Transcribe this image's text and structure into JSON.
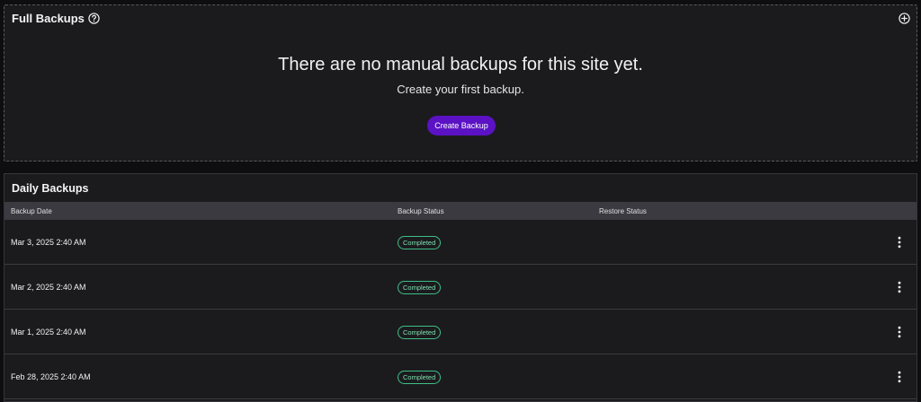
{
  "full_backups": {
    "title": "Full Backups",
    "empty_heading": "There are no manual backups for this site yet.",
    "empty_subtext": "Create your first backup.",
    "create_button_label": "Create Backup"
  },
  "daily_backups": {
    "title": "Daily Backups",
    "columns": {
      "backup_date": "Backup Date",
      "backup_status": "Backup Status",
      "restore_status": "Restore Status"
    },
    "rows": [
      {
        "date": "Mar 3, 2025 2:40 AM",
        "status": "Completed"
      },
      {
        "date": "Mar 2, 2025 2:40 AM",
        "status": "Completed"
      },
      {
        "date": "Mar 1, 2025 2:40 AM",
        "status": "Completed"
      },
      {
        "date": "Feb 28, 2025 2:40 AM",
        "status": "Completed"
      }
    ]
  },
  "colors": {
    "accent": "#5b12c4",
    "status_completed": "#3fbf86",
    "background": "#1b1b1e"
  },
  "icons": [
    "help-icon",
    "add-circle-icon",
    "more-vertical-icon"
  ]
}
